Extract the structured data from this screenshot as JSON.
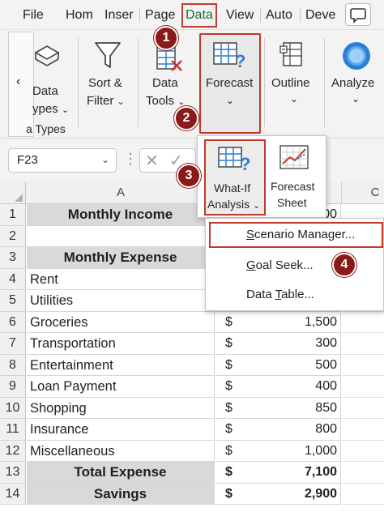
{
  "menubar": {
    "tabs": [
      "File",
      "Hom",
      "Inser",
      "Page",
      "Data",
      "View",
      "Auto",
      "Deve"
    ],
    "active_tab": "Data"
  },
  "ribbon": {
    "data_types": {
      "line1": "Data",
      "line2": "ypes",
      "group_label": "a Types"
    },
    "sort_filter": {
      "line1": "Sort &",
      "line2": "Filter"
    },
    "data_tools": {
      "line1": "Data",
      "line2": "Tools"
    },
    "forecast": {
      "label": "Forecast"
    },
    "outline": {
      "label": "Outline"
    },
    "analyze": {
      "label": "Analyze"
    }
  },
  "formula_bar": {
    "name_box": "F23"
  },
  "columns": [
    "A",
    "C"
  ],
  "rows": [
    {
      "num": "1",
      "a": "Monthly Income",
      "cur": "",
      "amt": "00",
      "style": "hdr"
    },
    {
      "num": "2",
      "a": "",
      "cur": "",
      "amt": "",
      "style": ""
    },
    {
      "num": "3",
      "a": "Monthly Expense",
      "cur": "",
      "amt": "",
      "style": "hdr"
    },
    {
      "num": "4",
      "a": "Rent",
      "cur": "",
      "amt": "",
      "style": ""
    },
    {
      "num": "5",
      "a": "Utilities",
      "cur": "",
      "amt": "",
      "style": ""
    },
    {
      "num": "6",
      "a": "Groceries",
      "cur": "$",
      "amt": "1,500",
      "style": ""
    },
    {
      "num": "7",
      "a": "Transportation",
      "cur": "$",
      "amt": "300",
      "style": ""
    },
    {
      "num": "8",
      "a": "Entertainment",
      "cur": "$",
      "amt": "500",
      "style": ""
    },
    {
      "num": "9",
      "a": "Loan Payment",
      "cur": "$",
      "amt": "400",
      "style": ""
    },
    {
      "num": "10",
      "a": "Shopping",
      "cur": "$",
      "amt": "850",
      "style": ""
    },
    {
      "num": "11",
      "a": "Insurance",
      "cur": "$",
      "amt": "800",
      "style": ""
    },
    {
      "num": "12",
      "a": "Miscellaneous",
      "cur": "$",
      "amt": "1,000",
      "style": ""
    },
    {
      "num": "13",
      "a": "Total Expense",
      "cur": "$",
      "amt": "7,100",
      "style": "hdr"
    },
    {
      "num": "14",
      "a": "Savings",
      "cur": "$",
      "amt": "2,900",
      "style": "hdr"
    }
  ],
  "forecast_panel": {
    "whatif": {
      "line1": "What-If",
      "line2": "Analysis"
    },
    "forecast_sheet": {
      "line1": "Forecast",
      "line2": "Sheet"
    }
  },
  "whatif_menu": {
    "items": [
      {
        "pre": "",
        "key": "S",
        "post": "cenario Manager..."
      },
      {
        "pre": "",
        "key": "G",
        "post": "oal Seek..."
      },
      {
        "pre": "Data ",
        "key": "T",
        "post": "able..."
      }
    ]
  },
  "badges": [
    "1",
    "2",
    "3",
    "4"
  ],
  "colors": {
    "accent_red": "#c0392b",
    "badge": "#8b1a1a",
    "excel_green": "#1e6b3a",
    "icon_blue": "#2a7fd4"
  }
}
